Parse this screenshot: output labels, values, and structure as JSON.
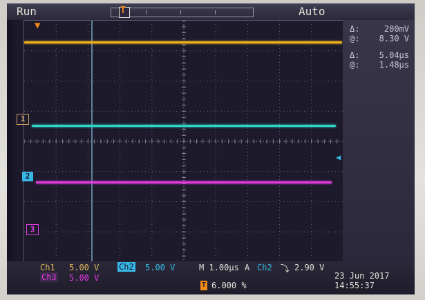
{
  "status": {
    "mode": "Run",
    "trigger_mode": "Auto"
  },
  "cursors": {
    "v_delta_symbol": "Δ:",
    "v_delta_value": "200mV",
    "v_at_symbol": "@:",
    "v_at_value": "8.30 V",
    "t_delta_symbol": "Δ:",
    "t_delta_value": "5.04μs",
    "t_at_symbol": "@:",
    "t_at_value": "1.48μs"
  },
  "channels": {
    "ch1": {
      "label": "Ch1",
      "scale": "5.00 V",
      "marker": "1",
      "color": "#2fd6c6"
    },
    "ch2": {
      "label": "Ch2",
      "scale": "5.00 V",
      "marker": "2",
      "color": "#35b8e6"
    },
    "ch3": {
      "label": "Ch3",
      "scale": "5.00 V",
      "marker": "3",
      "color": "#e23ce0"
    },
    "trigger_trace_color": "#f2b21c"
  },
  "timebase": {
    "label": "M 1.00μs",
    "trigger_prefix": "A",
    "trigger_source": "Ch2",
    "trigger_slope_icon": "falling-edge-icon",
    "trigger_slope_glyph": "⿽",
    "trigger_level": "2.90 V"
  },
  "trigger_position": {
    "icon": "trigger-marker-icon",
    "value": "6.000 %"
  },
  "datetime": {
    "date": "23 Jun  2017",
    "time": "14:55:37"
  }
}
